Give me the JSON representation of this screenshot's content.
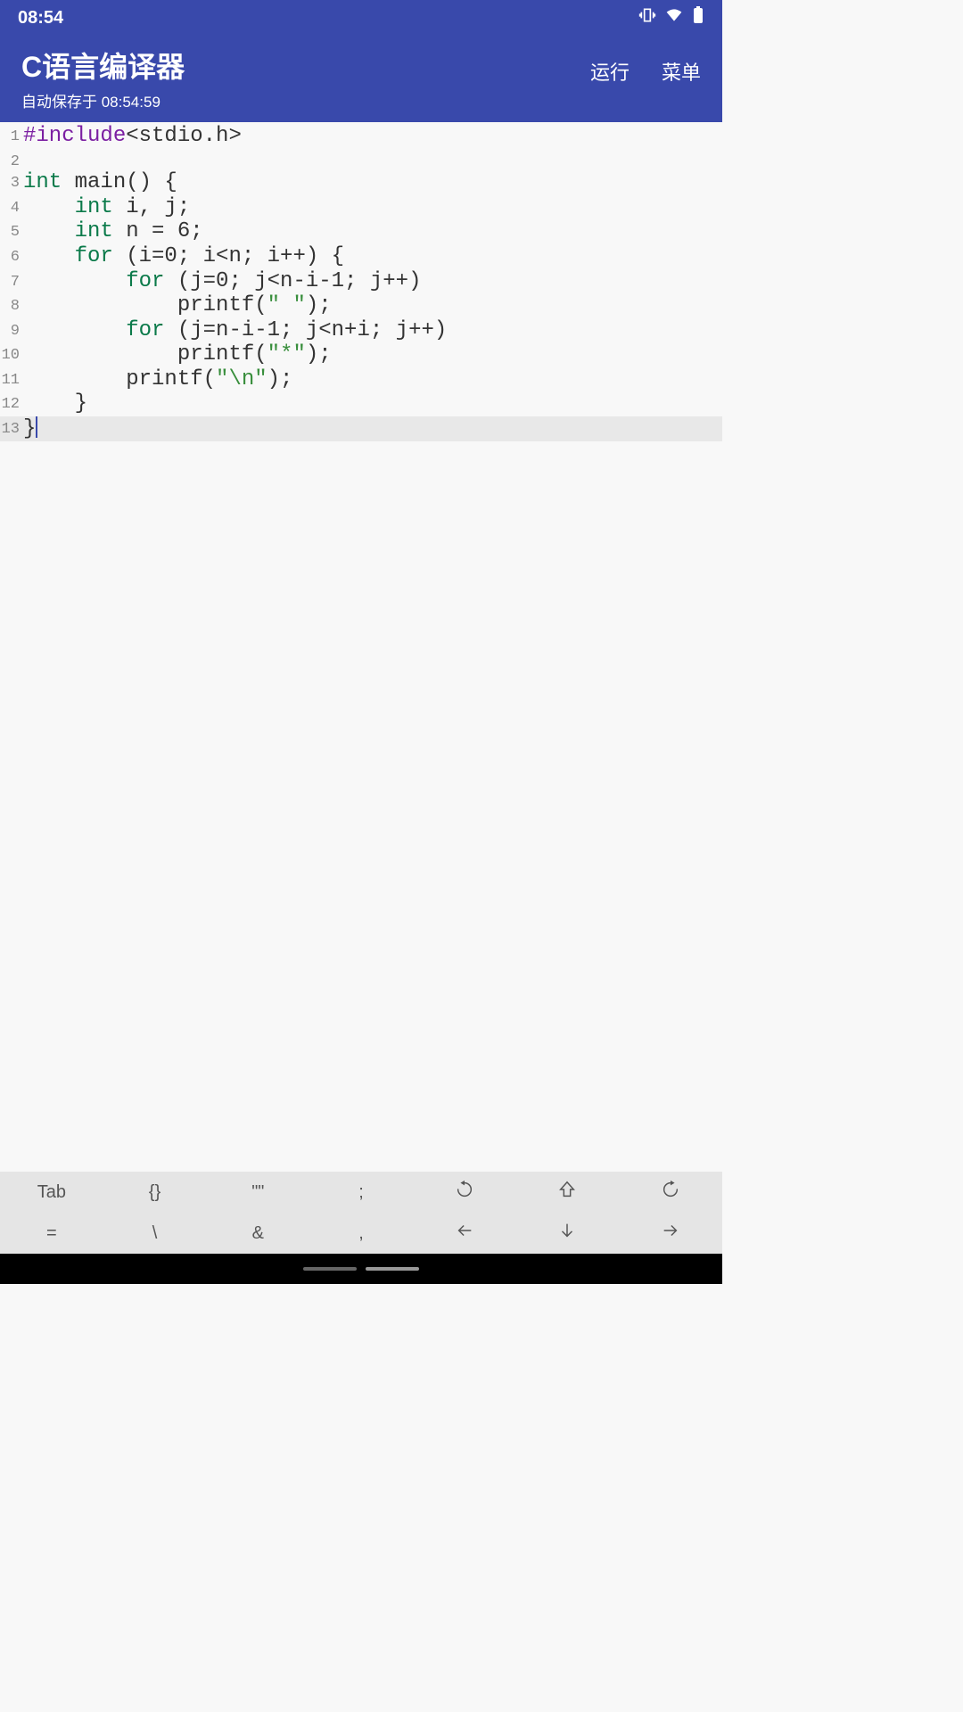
{
  "status": {
    "time": "08:54"
  },
  "header": {
    "title": "C语言编译器",
    "subtitle": "自动保存于 08:54:59",
    "run_label": "运行",
    "menu_label": "菜单"
  },
  "colors": {
    "primary": "#3949ab",
    "preproc": "#7b1fa2",
    "keyword": "#0b7a4a",
    "string": "#388e3c"
  },
  "code": {
    "cursor_line": 13,
    "lines": [
      {
        "n": 1,
        "tokens": [
          {
            "t": "#include",
            "c": "preproc"
          },
          {
            "t": "<stdio.h>",
            "c": "default"
          }
        ]
      },
      {
        "n": 2,
        "tokens": []
      },
      {
        "n": 3,
        "tokens": [
          {
            "t": "int ",
            "c": "keyword"
          },
          {
            "t": "main() {",
            "c": "default"
          }
        ]
      },
      {
        "n": 4,
        "tokens": [
          {
            "t": "    ",
            "c": "default"
          },
          {
            "t": "int ",
            "c": "keyword"
          },
          {
            "t": "i, j;",
            "c": "default"
          }
        ]
      },
      {
        "n": 5,
        "tokens": [
          {
            "t": "    ",
            "c": "default"
          },
          {
            "t": "int ",
            "c": "keyword"
          },
          {
            "t": "n = 6;",
            "c": "default"
          }
        ]
      },
      {
        "n": 6,
        "tokens": [
          {
            "t": "    ",
            "c": "default"
          },
          {
            "t": "for ",
            "c": "keyword"
          },
          {
            "t": "(i=0; i<n; i++) {",
            "c": "default"
          }
        ]
      },
      {
        "n": 7,
        "tokens": [
          {
            "t": "        ",
            "c": "default"
          },
          {
            "t": "for ",
            "c": "keyword"
          },
          {
            "t": "(j=0; j<n-i-1; j++)",
            "c": "default"
          }
        ]
      },
      {
        "n": 8,
        "tokens": [
          {
            "t": "            printf(",
            "c": "default"
          },
          {
            "t": "\" \"",
            "c": "string"
          },
          {
            "t": ");",
            "c": "default"
          }
        ]
      },
      {
        "n": 9,
        "tokens": [
          {
            "t": "        ",
            "c": "default"
          },
          {
            "t": "for ",
            "c": "keyword"
          },
          {
            "t": "(j=n-i-1; j<n+i; j++)",
            "c": "default"
          }
        ]
      },
      {
        "n": 10,
        "tokens": [
          {
            "t": "            printf(",
            "c": "default"
          },
          {
            "t": "\"*\"",
            "c": "string"
          },
          {
            "t": ");",
            "c": "default"
          }
        ]
      },
      {
        "n": 11,
        "tokens": [
          {
            "t": "        printf(",
            "c": "default"
          },
          {
            "t": "\"\\n\"",
            "c": "string"
          },
          {
            "t": ");",
            "c": "default"
          }
        ]
      },
      {
        "n": 12,
        "tokens": [
          {
            "t": "    }",
            "c": "default"
          }
        ]
      },
      {
        "n": 13,
        "tokens": [
          {
            "t": "}",
            "c": "default"
          }
        ],
        "has_cursor": true
      }
    ]
  },
  "toolbar": {
    "row1": [
      "Tab",
      "{}",
      "\"\"",
      ";",
      "undo-icon",
      "shift-up-icon",
      "redo-icon"
    ],
    "row2": [
      "=",
      "\\",
      "&",
      ",",
      "arrow-left-icon",
      "arrow-down-icon",
      "arrow-right-icon"
    ]
  }
}
